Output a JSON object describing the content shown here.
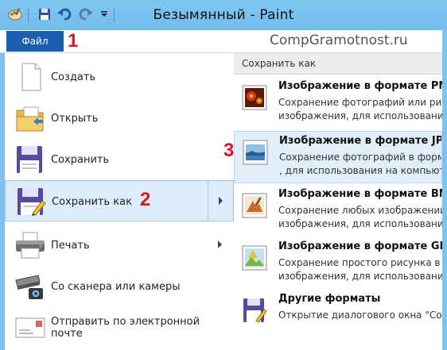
{
  "window": {
    "title": "Безымянный - Paint"
  },
  "quick_access": {
    "icons": [
      "paint-app-icon",
      "save-icon",
      "undo-icon",
      "redo-icon",
      "customize-dropdown-icon"
    ]
  },
  "tabs": {
    "file_label": "Файл"
  },
  "watermark": "CompGramotnost.ru",
  "markers": {
    "m1": "1",
    "m2": "2",
    "m3": "3"
  },
  "left_menu": {
    "items": [
      {
        "label": "Создать",
        "icon": "new-document-icon"
      },
      {
        "label": "Открыть",
        "icon": "open-folder-icon"
      },
      {
        "label": "Сохранить",
        "icon": "save-disk-icon"
      },
      {
        "label": "Сохранить как",
        "icon": "save-as-icon"
      },
      {
        "label": "Печать",
        "icon": "printer-icon"
      },
      {
        "label": "Со сканера или камеры",
        "icon": "scanner-camera-icon"
      },
      {
        "label": "Отправить по электронной почте",
        "icon": "email-icon"
      }
    ]
  },
  "save_as_menu": {
    "header": "Сохранить как",
    "items": [
      {
        "title": "Изображение в формате PNG",
        "desc": "Сохранение фотографий или рисунков\nизображения, для использования на",
        "icon": "png-image-icon"
      },
      {
        "title": "Изображение в формате JPEG",
        "desc": "Сохранение фотографий в формате\n, для использования на компьютере",
        "icon": "jpeg-image-icon"
      },
      {
        "title": "Изображение в формате BMP",
        "desc": "Сохранение любых изображений\nизображения, для использования на",
        "icon": "bmp-image-icon"
      },
      {
        "title": "Изображение в формате GIF",
        "desc": "Сохранение простого рисунка в ф\nизображения, для использования на",
        "icon": "gif-image-icon"
      },
      {
        "title": "Другие форматы",
        "desc": "Открытие диалогового окна \"Сохр",
        "icon": "other-formats-icon"
      }
    ]
  },
  "colors": {
    "title_bar": "#7ec3ef",
    "file_tab": "#1b5fb3",
    "marker": "#d71920",
    "selected_bg": "#dcecfb"
  }
}
